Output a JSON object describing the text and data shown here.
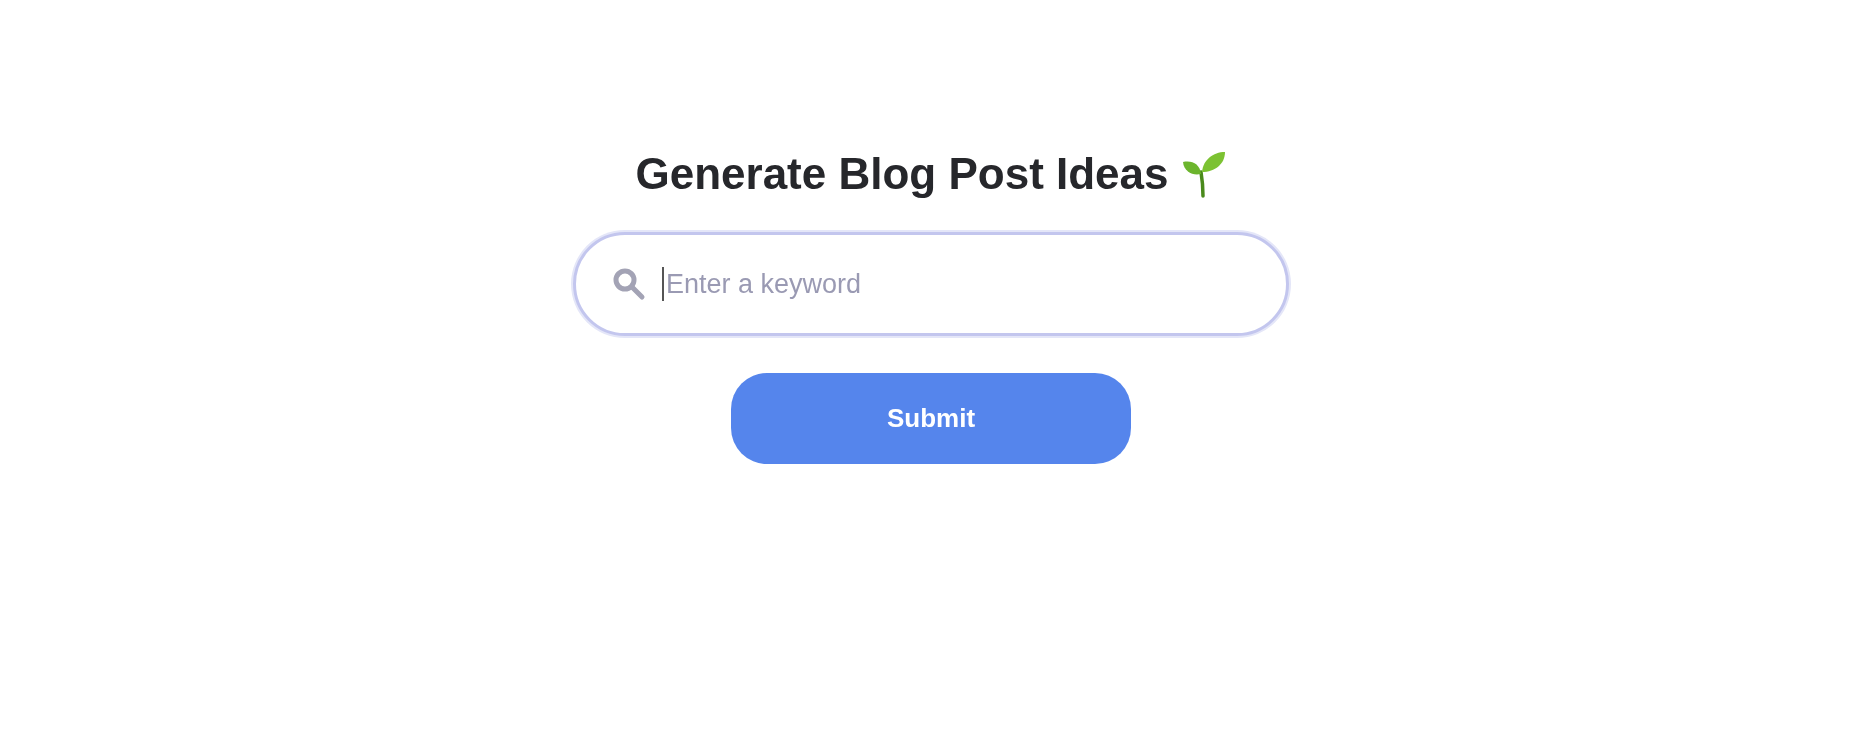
{
  "heading": "Generate Blog Post Ideas",
  "search": {
    "placeholder": "Enter a keyword",
    "focused": true
  },
  "buttons": [
    "Submit"
  ]
}
